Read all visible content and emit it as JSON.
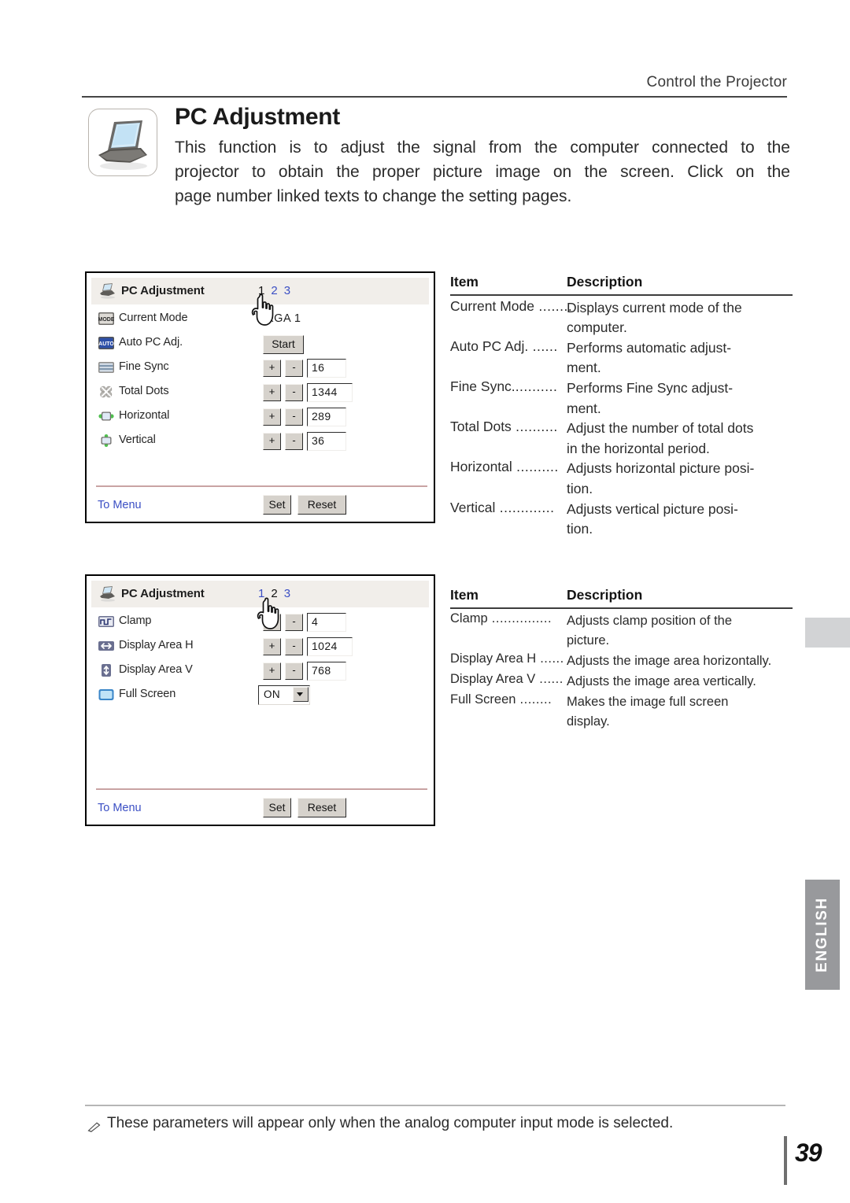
{
  "header": {
    "running_title": "Control the Projector"
  },
  "intro": {
    "icon": "laptop-icon",
    "title": "PC Adjustment",
    "lines": [
      "This function is to adjust the signal from the computer connected to the",
      "projector to obtain the proper picture image on the screen. Click on the",
      "page number linked texts to change the setting pages."
    ]
  },
  "panel1": {
    "title": "PC Adjustment",
    "title_icon": "projector-icon",
    "page_links": [
      {
        "label": "1",
        "current": true
      },
      {
        "label": "2",
        "current": false
      },
      {
        "label": "3",
        "current": false
      }
    ],
    "rows": [
      {
        "icon": "mode-icon",
        "label": "Current Mode",
        "type": "text",
        "value": "XGA 1"
      },
      {
        "icon": "auto-icon",
        "label": "Auto PC Adj.",
        "type": "button",
        "value": "Start"
      },
      {
        "icon": "fine-sync-icon",
        "label": "Fine Sync",
        "type": "stepper",
        "value": "16",
        "plus": "+",
        "minus": "-"
      },
      {
        "icon": "total-dots-icon",
        "label": "Total Dots",
        "type": "stepper",
        "value": "1344",
        "plus": "+",
        "minus": "-"
      },
      {
        "icon": "horizontal-icon",
        "label": "Horizontal",
        "type": "stepper",
        "value": "289",
        "plus": "+",
        "minus": "-"
      },
      {
        "icon": "vertical-icon",
        "label": "Vertical",
        "type": "stepper",
        "value": "36",
        "plus": "+",
        "minus": "-"
      }
    ],
    "footer": {
      "to_menu": "To Menu",
      "set": "Set",
      "reset": "Reset"
    }
  },
  "panel2": {
    "title": "PC Adjustment",
    "title_icon": "projector-icon",
    "page_links": [
      {
        "label": "1",
        "current": false
      },
      {
        "label": "2",
        "current": true
      },
      {
        "label": "3",
        "current": false
      }
    ],
    "rows": [
      {
        "icon": "clamp-icon",
        "label": "Clamp",
        "type": "stepper",
        "value": "4",
        "plus": "+",
        "minus": "-"
      },
      {
        "icon": "display-area-h-icon",
        "label": "Display Area H",
        "type": "stepper",
        "value": "1024",
        "plus": "+",
        "minus": "-"
      },
      {
        "icon": "display-area-v-icon",
        "label": "Display Area V",
        "type": "stepper",
        "value": "768",
        "plus": "+",
        "minus": "-"
      },
      {
        "icon": "full-screen-icon",
        "label": "Full Screen",
        "type": "select",
        "value": "ON"
      }
    ],
    "footer": {
      "to_menu": "To Menu",
      "set": "Set",
      "reset": "Reset"
    }
  },
  "desc_table_1": {
    "head_item": "Item",
    "head_description": "Description",
    "rows": [
      {
        "item": "Current Mode",
        "dots": " ........",
        "line1": "Displays current mode of the",
        "line2": "computer."
      },
      {
        "item": "Auto PC Adj.",
        "dots": " ......",
        "line1": "Performs automatic adjust-",
        "line2": "ment."
      },
      {
        "item": "Fine Sync.",
        "dots": "..........",
        "line1": "Performs Fine Sync adjust-",
        "line2": "ment."
      },
      {
        "item": "Total Dots",
        "dots": " ..........",
        "line1": "Adjust the number of total dots",
        "line2": "in the horizontal period."
      },
      {
        "item": "Horizontal",
        "dots": " ..........",
        "line1": "Adjusts horizontal picture posi-",
        "line2": "tion."
      },
      {
        "item": "Vertical",
        "dots": " .............",
        "line1": "Adjusts vertical picture posi-",
        "line2": "tion."
      }
    ]
  },
  "desc_table_2": {
    "head_item": "Item",
    "head_description": "Description",
    "rows": [
      {
        "item": "Clamp",
        "dots": " ...............",
        "line1": "Adjusts clamp position of the",
        "line2": "picture."
      },
      {
        "item": "Display Area H",
        "dots": " ......",
        "line1": "Adjusts the image area horizontally.",
        "line2": ""
      },
      {
        "item": "Display Area V",
        "dots": " ......",
        "line1": "Adjusts the image area vertically.",
        "line2": ""
      },
      {
        "item": "Full Screen",
        "dots": " ........",
        "line1": "Makes the image full screen",
        "line2": "display."
      }
    ]
  },
  "side_tab": {
    "label": "ENGLISH"
  },
  "footnote": {
    "icon": "pencil-note-icon",
    "text": "These parameters will appear only when the analog computer input mode is selected."
  },
  "page": {
    "number": "39"
  },
  "colors": {
    "link_blue": "#3b4fc4",
    "titlebar_bg": "#f1eeea",
    "button_face": "#d6d2cc",
    "tab_grey": "#98999c",
    "divider_pink": "#c9a3a3"
  }
}
